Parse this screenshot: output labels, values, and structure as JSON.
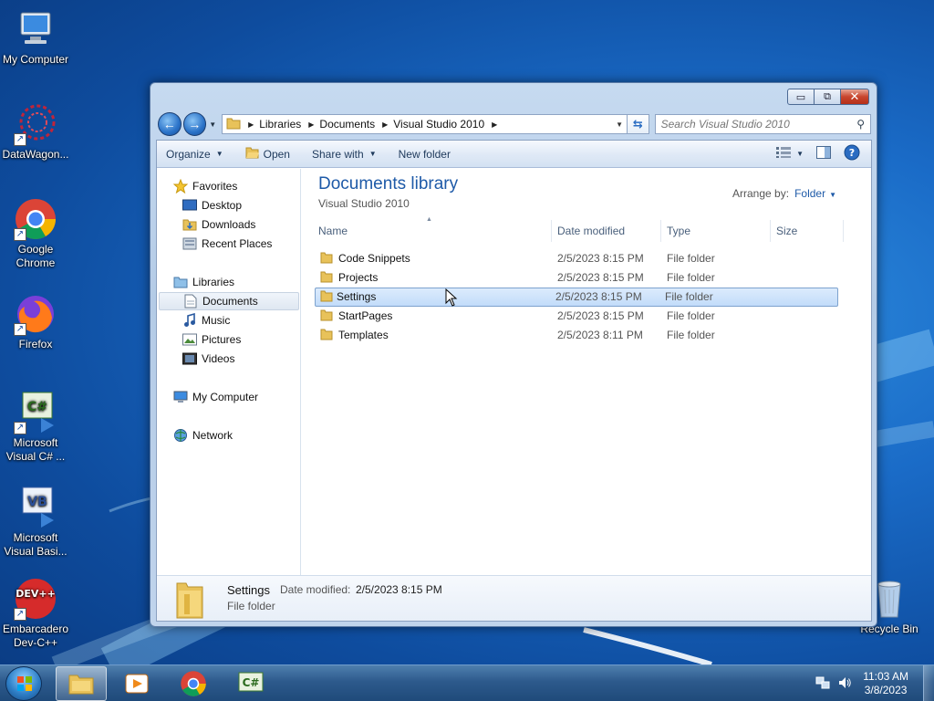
{
  "desktop": {
    "icons": [
      {
        "label": "My Computer",
        "icon": "computer-icon"
      },
      {
        "label": "DataWagon...",
        "icon": "datawagon-icon"
      },
      {
        "label": "Google Chrome",
        "icon": "chrome-icon"
      },
      {
        "label": "Firefox",
        "icon": "firefox-icon"
      },
      {
        "label": "Microsoft Visual C# ...",
        "icon": "visual-csharp-icon"
      },
      {
        "label": "Microsoft Visual Basi...",
        "icon": "visual-basic-icon"
      },
      {
        "label": "Embarcadero Dev-C++",
        "icon": "devcpp-icon"
      },
      {
        "label": "Recycle Bin",
        "icon": "recycle-bin-icon"
      }
    ],
    "vb_glyph": "VB",
    "cs_glyph": "C#",
    "dev_glyph": "DEV++"
  },
  "window": {
    "controls": {
      "minimize": "▭",
      "maximize": "⧉",
      "close": "✕"
    },
    "nav": {
      "back": "←",
      "forward": "→"
    },
    "breadcrumb": [
      "Libraries",
      "Documents",
      "Visual Studio 2010"
    ],
    "search_placeholder": "Search Visual Studio 2010",
    "toolbar": {
      "organize": "Organize",
      "open": "Open",
      "share_with": "Share with",
      "new_folder": "New folder"
    },
    "nav_pane": {
      "favorites": "Favorites",
      "desktop": "Desktop",
      "downloads": "Downloads",
      "recent_places": "Recent Places",
      "libraries": "Libraries",
      "documents": "Documents",
      "music": "Music",
      "pictures": "Pictures",
      "videos": "Videos",
      "my_computer": "My Computer",
      "network": "Network"
    },
    "library": {
      "title": "Documents library",
      "subtitle": "Visual Studio 2010",
      "arrange_label": "Arrange by:",
      "arrange_value": "Folder"
    },
    "columns": {
      "name": "Name",
      "date": "Date modified",
      "type": "Type",
      "size": "Size"
    },
    "files": [
      {
        "name": "Code Snippets",
        "date": "2/5/2023 8:15 PM",
        "type": "File folder",
        "selected": false
      },
      {
        "name": "Projects",
        "date": "2/5/2023 8:15 PM",
        "type": "File folder",
        "selected": false
      },
      {
        "name": "Settings",
        "date": "2/5/2023 8:15 PM",
        "type": "File folder",
        "selected": true
      },
      {
        "name": "StartPages",
        "date": "2/5/2023 8:15 PM",
        "type": "File folder",
        "selected": false
      },
      {
        "name": "Templates",
        "date": "2/5/2023 8:11 PM",
        "type": "File folder",
        "selected": false
      }
    ],
    "details": {
      "name": "Settings",
      "date_label": "Date modified:",
      "date_value": "2/5/2023 8:15 PM",
      "type": "File folder"
    }
  },
  "taskbar": {
    "time": "11:03 AM",
    "date": "3/8/2023",
    "cs_glyph": "C#"
  },
  "colors": {
    "accent": "#1e5aa8",
    "folder": "#e8c25a",
    "selection": "#c2dcfa"
  }
}
